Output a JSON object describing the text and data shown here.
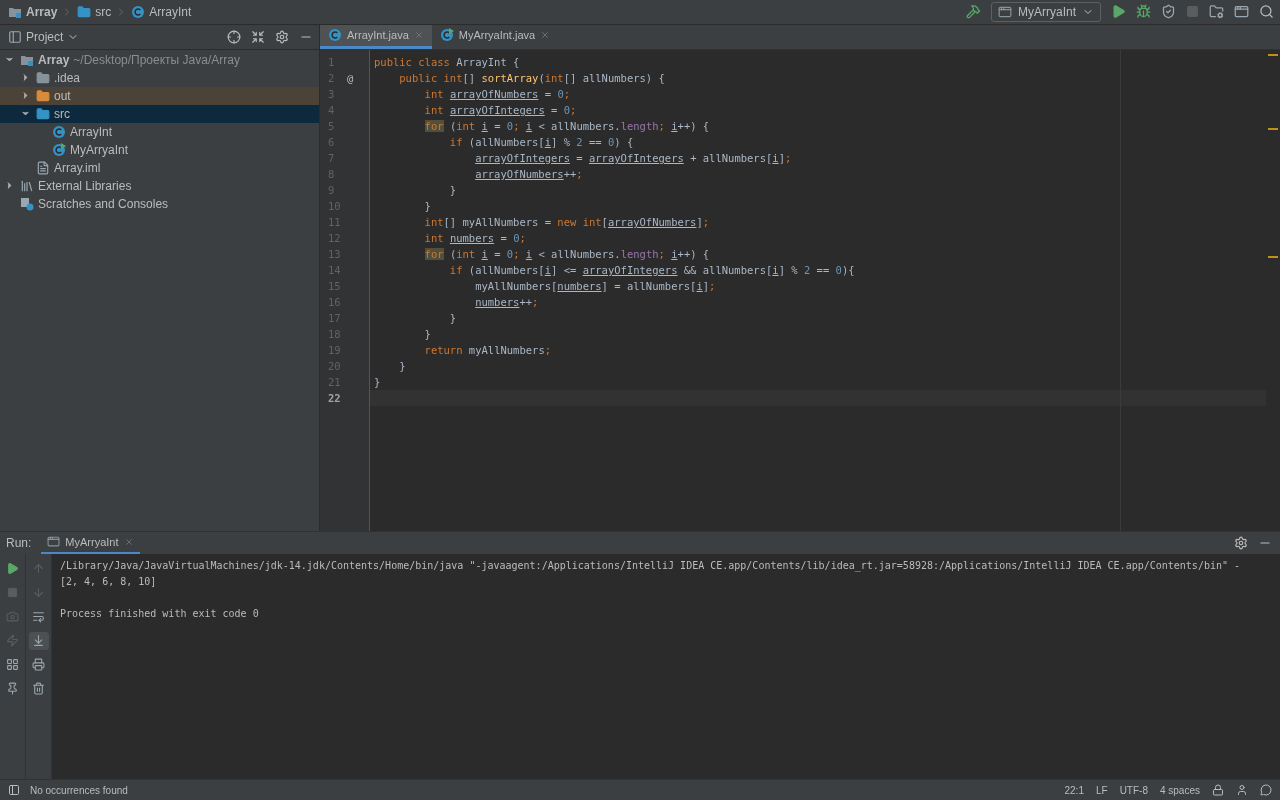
{
  "breadcrumbs": [
    {
      "label": "Array",
      "kind": "module"
    },
    {
      "label": "src",
      "kind": "folder"
    },
    {
      "label": "ArrayInt",
      "kind": "class"
    }
  ],
  "toolbar": {
    "run_config": "MyArryaInt",
    "stop_disabled": true
  },
  "project_panel": {
    "title": "Project",
    "tree": [
      {
        "label": "Array",
        "hint": "~/Desktop/Проекты Java/Array",
        "kind": "module",
        "expanded": true,
        "selected": false,
        "children": [
          {
            "label": ".idea",
            "kind": "folder",
            "expanded": false,
            "selected": false
          },
          {
            "label": "out",
            "kind": "excluded-folder",
            "expanded": false,
            "selected": false
          },
          {
            "label": "src",
            "kind": "source-folder",
            "expanded": true,
            "selected": true,
            "children": [
              {
                "label": "ArrayInt",
                "kind": "class",
                "selected": false
              },
              {
                "label": "MyArryaInt",
                "kind": "runnable-class",
                "selected": false
              }
            ]
          },
          {
            "label": "Array.iml",
            "kind": "file",
            "selected": false
          }
        ]
      },
      {
        "label": "External Libraries",
        "kind": "library",
        "expanded": false,
        "selected": false
      },
      {
        "label": "Scratches and Consoles",
        "kind": "scratch",
        "selected": false
      }
    ]
  },
  "editor": {
    "tabs": [
      {
        "label": "ArrayInt.java",
        "kind": "class",
        "selected": true
      },
      {
        "label": "MyArryaInt.java",
        "kind": "runnable-class",
        "selected": false
      }
    ],
    "lines": [
      {
        "n": "1",
        "current": false,
        "tokens": [
          {
            "text": "public class ",
            "kind": "keyword"
          },
          {
            "text": "ArrayInt {",
            "kind": "plain"
          }
        ]
      },
      {
        "n": "2",
        "current": false,
        "mark": "@",
        "tokens": [
          {
            "text": "    public int",
            "kind": "keyword"
          },
          {
            "text": "[] ",
            "kind": "plain"
          },
          {
            "text": "sortArray",
            "kind": "method"
          },
          {
            "text": "(",
            "kind": "plain"
          },
          {
            "text": "int",
            "kind": "keyword"
          },
          {
            "text": "[] allNumbers) {",
            "kind": "plain"
          }
        ]
      },
      {
        "n": "3",
        "current": false,
        "tokens": [
          {
            "text": "        int ",
            "kind": "keyword"
          },
          {
            "text": "arrayOfNumbers",
            "kind": "variable"
          },
          {
            "text": " = ",
            "kind": "plain"
          },
          {
            "text": "0",
            "kind": "number"
          },
          {
            "text": ";",
            "kind": "keyword"
          }
        ]
      },
      {
        "n": "4",
        "current": false,
        "tokens": [
          {
            "text": "        int ",
            "kind": "keyword"
          },
          {
            "text": "arrayOfIntegers",
            "kind": "variable"
          },
          {
            "text": " = ",
            "kind": "plain"
          },
          {
            "text": "0",
            "kind": "number"
          },
          {
            "text": ";",
            "kind": "keyword"
          }
        ]
      },
      {
        "n": "5",
        "current": false,
        "tokens": [
          {
            "text": "        for",
            "kind": "highlighted"
          },
          {
            "text": " (",
            "kind": "plain"
          },
          {
            "text": "int ",
            "kind": "keyword"
          },
          {
            "text": "i",
            "kind": "variable"
          },
          {
            "text": " = ",
            "kind": "plain"
          },
          {
            "text": "0",
            "kind": "number"
          },
          {
            "text": "; ",
            "kind": "keyword"
          },
          {
            "text": "i",
            "kind": "variable"
          },
          {
            "text": " < allNumbers.",
            "kind": "plain"
          },
          {
            "text": "length",
            "kind": "field"
          },
          {
            "text": "; ",
            "kind": "keyword"
          },
          {
            "text": "i",
            "kind": "variable"
          },
          {
            "text": "++) {",
            "kind": "plain"
          }
        ]
      },
      {
        "n": "6",
        "current": false,
        "tokens": [
          {
            "text": "            if ",
            "kind": "keyword"
          },
          {
            "text": "(allNumbers[",
            "kind": "plain"
          },
          {
            "text": "i",
            "kind": "variable"
          },
          {
            "text": "] % ",
            "kind": "plain"
          },
          {
            "text": "2",
            "kind": "number"
          },
          {
            "text": " == ",
            "kind": "plain"
          },
          {
            "text": "0",
            "kind": "number"
          },
          {
            "text": ") {",
            "kind": "plain"
          }
        ]
      },
      {
        "n": "7",
        "current": false,
        "tokens": [
          {
            "text": "                arrayOfIntegers",
            "kind": "variable"
          },
          {
            "text": " = ",
            "kind": "plain"
          },
          {
            "text": "arrayOfIntegers",
            "kind": "variable"
          },
          {
            "text": " + allNumbers[",
            "kind": "plain"
          },
          {
            "text": "i",
            "kind": "variable"
          },
          {
            "text": "]",
            "kind": "plain"
          },
          {
            "text": ";",
            "kind": "keyword"
          }
        ]
      },
      {
        "n": "8",
        "current": false,
        "tokens": [
          {
            "text": "                arrayOfNumbers",
            "kind": "variable"
          },
          {
            "text": "++",
            "kind": "plain"
          },
          {
            "text": ";",
            "kind": "keyword"
          }
        ]
      },
      {
        "n": "9",
        "current": false,
        "tokens": [
          {
            "text": "            }",
            "kind": "plain"
          }
        ]
      },
      {
        "n": "10",
        "current": false,
        "tokens": [
          {
            "text": "        }",
            "kind": "plain"
          }
        ]
      },
      {
        "n": "11",
        "current": false,
        "tokens": [
          {
            "text": "        int",
            "kind": "keyword"
          },
          {
            "text": "[] myAllNumbers = ",
            "kind": "plain"
          },
          {
            "text": "new int",
            "kind": "keyword"
          },
          {
            "text": "[",
            "kind": "plain"
          },
          {
            "text": "arrayOfNumbers",
            "kind": "variable"
          },
          {
            "text": "]",
            "kind": "plain"
          },
          {
            "text": ";",
            "kind": "keyword"
          }
        ]
      },
      {
        "n": "12",
        "current": false,
        "tokens": [
          {
            "text": "        int ",
            "kind": "keyword"
          },
          {
            "text": "numbers",
            "kind": "variable"
          },
          {
            "text": " = ",
            "kind": "plain"
          },
          {
            "text": "0",
            "kind": "number"
          },
          {
            "text": ";",
            "kind": "keyword"
          }
        ]
      },
      {
        "n": "13",
        "current": false,
        "tokens": [
          {
            "text": "        for",
            "kind": "highlighted"
          },
          {
            "text": " (",
            "kind": "plain"
          },
          {
            "text": "int ",
            "kind": "keyword"
          },
          {
            "text": "i",
            "kind": "variable"
          },
          {
            "text": " = ",
            "kind": "plain"
          },
          {
            "text": "0",
            "kind": "number"
          },
          {
            "text": "; ",
            "kind": "keyword"
          },
          {
            "text": "i",
            "kind": "variable"
          },
          {
            "text": " < allNumbers.",
            "kind": "plain"
          },
          {
            "text": "length",
            "kind": "field"
          },
          {
            "text": "; ",
            "kind": "keyword"
          },
          {
            "text": "i",
            "kind": "variable"
          },
          {
            "text": "++) {",
            "kind": "plain"
          }
        ]
      },
      {
        "n": "14",
        "current": false,
        "tokens": [
          {
            "text": "            if ",
            "kind": "keyword"
          },
          {
            "text": "(allNumbers[",
            "kind": "plain"
          },
          {
            "text": "i",
            "kind": "variable"
          },
          {
            "text": "] <= ",
            "kind": "plain"
          },
          {
            "text": "arrayOfIntegers",
            "kind": "variable"
          },
          {
            "text": " && allNumbers[",
            "kind": "plain"
          },
          {
            "text": "i",
            "kind": "variable"
          },
          {
            "text": "] % ",
            "kind": "plain"
          },
          {
            "text": "2",
            "kind": "number"
          },
          {
            "text": " == ",
            "kind": "plain"
          },
          {
            "text": "0",
            "kind": "number"
          },
          {
            "text": "){",
            "kind": "plain"
          }
        ]
      },
      {
        "n": "15",
        "current": false,
        "tokens": [
          {
            "text": "                myAllNumbers[",
            "kind": "plain"
          },
          {
            "text": "numbers",
            "kind": "variable"
          },
          {
            "text": "] = allNumbers[",
            "kind": "plain"
          },
          {
            "text": "i",
            "kind": "variable"
          },
          {
            "text": "]",
            "kind": "plain"
          },
          {
            "text": ";",
            "kind": "keyword"
          }
        ]
      },
      {
        "n": "16",
        "current": false,
        "tokens": [
          {
            "text": "                numbers",
            "kind": "variable"
          },
          {
            "text": "++",
            "kind": "plain"
          },
          {
            "text": ";",
            "kind": "keyword"
          }
        ]
      },
      {
        "n": "17",
        "current": false,
        "tokens": [
          {
            "text": "            }",
            "kind": "plain"
          }
        ]
      },
      {
        "n": "18",
        "current": false,
        "tokens": [
          {
            "text": "        }",
            "kind": "plain"
          }
        ]
      },
      {
        "n": "19",
        "current": false,
        "tokens": [
          {
            "text": "        return ",
            "kind": "keyword"
          },
          {
            "text": "myAllNumbers",
            "kind": "plain"
          },
          {
            "text": ";",
            "kind": "keyword"
          }
        ]
      },
      {
        "n": "20",
        "current": false,
        "tokens": [
          {
            "text": "    }",
            "kind": "plain"
          }
        ]
      },
      {
        "n": "21",
        "current": false,
        "tokens": [
          {
            "text": "}",
            "kind": "plain"
          }
        ]
      },
      {
        "n": "22",
        "current": true
      }
    ]
  },
  "run_panel": {
    "label": "Run:",
    "tab": "MyArryaInt",
    "output": [
      "/Library/Java/JavaVirtualMachines/jdk-14.jdk/Contents/Home/bin/java \"-javaagent:/Applications/IntelliJ IDEA CE.app/Contents/lib/idea_rt.jar=58928:/Applications/IntelliJ IDEA CE.app/Contents/bin\" -",
      "[2, 4, 6, 8, 10]",
      "Process finished with exit code 0"
    ]
  },
  "status_bar": {
    "message": "No occurrences found",
    "items": [
      "22:1",
      "LF",
      "UTF-8",
      "4 spaces"
    ]
  }
}
